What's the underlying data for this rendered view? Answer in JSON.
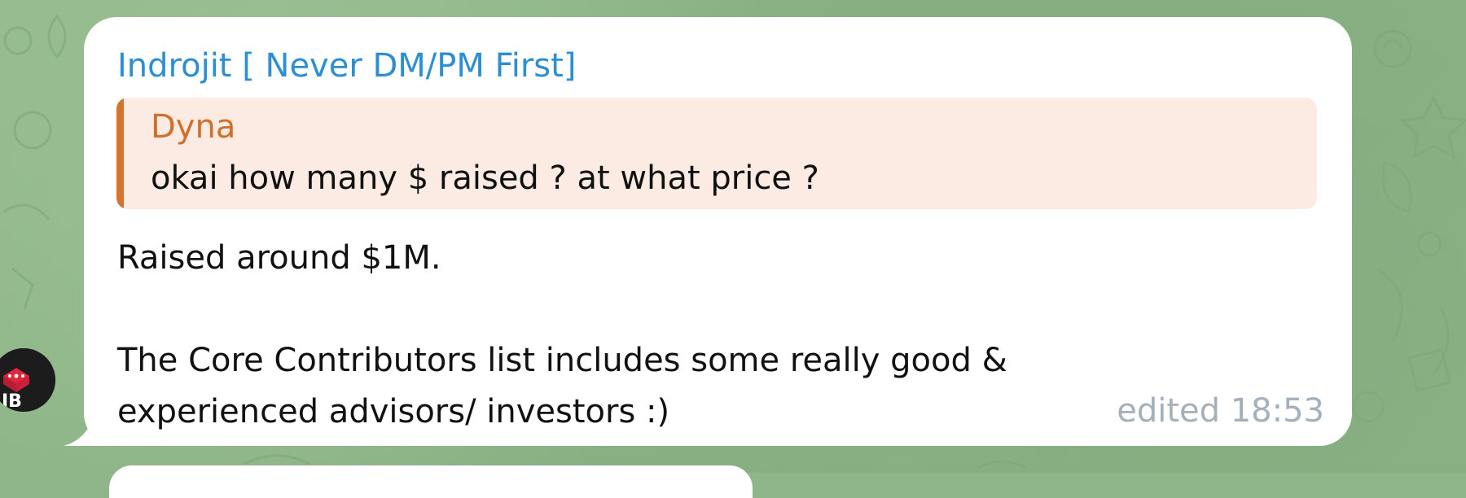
{
  "message": {
    "sender_name": "Indrojit [ Never DM/PM First]",
    "sender_color": "#2c8fd1",
    "reply": {
      "author": "Dyna",
      "text": "okai how many $ raised ? at what price ?",
      "accent_color": "#d6732f",
      "background_color": "#fbebe2"
    },
    "body_lines": [
      "Raised around $1M.",
      "",
      "The Core Contributors list includes some really good &",
      "experienced advisors/ investors :)"
    ],
    "edited_label": "edited",
    "time": "18:53"
  },
  "avatar": {
    "icon": "dice-logo-avatar",
    "text": "IB"
  },
  "theme": {
    "chat_background": "#8fb58a",
    "bubble_background": "#ffffff"
  }
}
